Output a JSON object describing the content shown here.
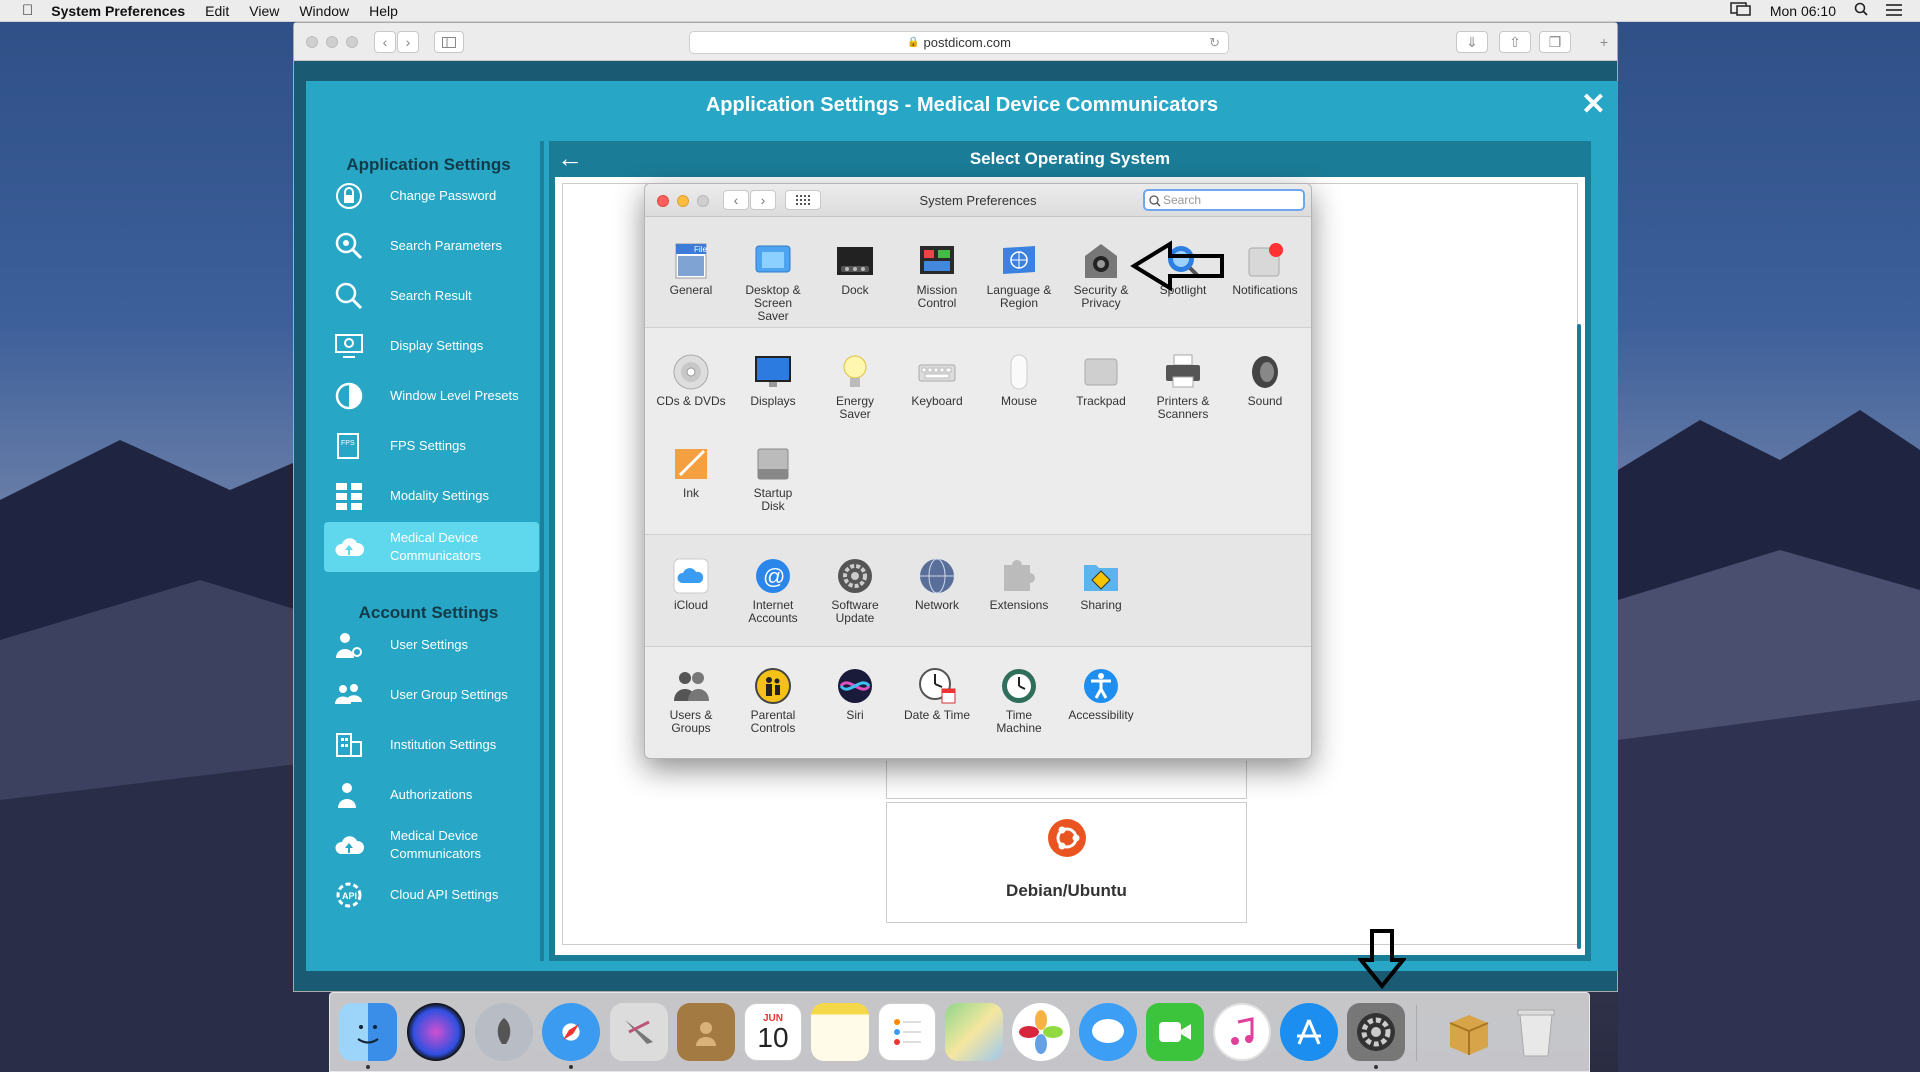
{
  "menubar": {
    "app": "System Preferences",
    "items": [
      "Edit",
      "View",
      "Window",
      "Help"
    ],
    "clock": "Mon 06:10"
  },
  "browser": {
    "url": "postdicom.com"
  },
  "modal": {
    "title": "Application Settings - Medical Device Communicators",
    "section_app": "Application Settings",
    "section_account": "Account Settings",
    "app_items": [
      "Change Password",
      "Search Parameters",
      "Search Result",
      "Display Settings",
      "Window Level Presets",
      "FPS Settings",
      "Modality Settings",
      "Medical Device Communicators"
    ],
    "account_items": [
      "User Settings",
      "User Group Settings",
      "Institution Settings",
      "Authorizations",
      "Medical Device Communicators",
      "Cloud API Settings"
    ],
    "content_title": "Select Operating System",
    "os_card": "Debian/Ubuntu"
  },
  "sysprefs": {
    "title": "System Preferences",
    "search_placeholder": "Search",
    "row1": [
      "General",
      "Desktop & Screen Saver",
      "Dock",
      "Mission Control",
      "Language & Region",
      "Security & Privacy",
      "Spotlight",
      "Notifications"
    ],
    "row2": [
      "CDs & DVDs",
      "Displays",
      "Energy Saver",
      "Keyboard",
      "Mouse",
      "Trackpad",
      "Printers & Scanners",
      "Sound"
    ],
    "row3": [
      "Ink",
      "Startup Disk"
    ],
    "row4": [
      "iCloud",
      "Internet Accounts",
      "Software Update",
      "Network",
      "Extensions",
      "Sharing"
    ],
    "row5": [
      "Users & Groups",
      "Parental Controls",
      "Siri",
      "Date & Time",
      "Time Machine",
      "Accessibility"
    ]
  },
  "dock": {
    "calendar_month": "JUN",
    "calendar_day": "10"
  }
}
